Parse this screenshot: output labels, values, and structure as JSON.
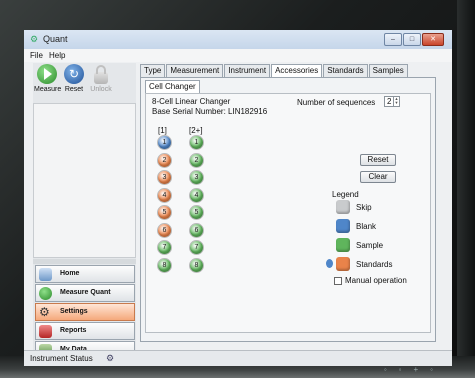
{
  "window": {
    "title": "Quant"
  },
  "menu": {
    "items": [
      "File",
      "Help"
    ]
  },
  "toolbar": {
    "measure": {
      "label": "Measure",
      "icon": "play-icon"
    },
    "reset": {
      "label": "Reset",
      "icon": "reset-icon"
    },
    "unlock": {
      "label": "Unlock",
      "icon": "padlock-icon"
    }
  },
  "nav": {
    "home": "Home",
    "measure_quant": "Measure Quant",
    "settings": "Settings",
    "reports": "Reports",
    "my_data": "My Data"
  },
  "tabs": [
    "Type",
    "Measurement",
    "Instrument",
    "Accessories",
    "Standards",
    "Samples"
  ],
  "active_tab": "Accessories",
  "subtab": "Cell Changer",
  "changer": {
    "name": "8-Cell Linear Changer",
    "serial": "Base Serial Number: LIN182916",
    "sequences_label": "Number of sequences",
    "sequences_value": "2"
  },
  "columns": {
    "col1_header": "[1]",
    "col2_header": "[2+]",
    "col1_numbers": [
      "1",
      "2",
      "3",
      "4",
      "5",
      "6",
      "7",
      "8"
    ],
    "col2_numbers": [
      "1",
      "2",
      "3",
      "4",
      "5",
      "6",
      "7",
      "8"
    ],
    "col1_types": [
      "blank",
      "standard",
      "standard",
      "standard",
      "standard",
      "standard",
      "sample",
      "sample"
    ],
    "col2_types": [
      "sample",
      "sample",
      "sample",
      "sample",
      "sample",
      "sample",
      "sample",
      "sample"
    ]
  },
  "buttons": {
    "reset": "Reset",
    "clear": "Clear"
  },
  "legend": {
    "title": "Legend",
    "items": [
      {
        "label": "Skip",
        "color": "#c9cbcd"
      },
      {
        "label": "Blank",
        "color": "#4f86c9"
      },
      {
        "label": "Sample",
        "color": "#5fb55c"
      },
      {
        "label": "Standards",
        "color": "#e9834a"
      }
    ]
  },
  "manual_operation": "Manual operation",
  "status": {
    "text": "Instrument Status"
  },
  "colors": {
    "blank": "#4f86c9",
    "standard": "#e9834a",
    "sample": "#5fb55c"
  }
}
